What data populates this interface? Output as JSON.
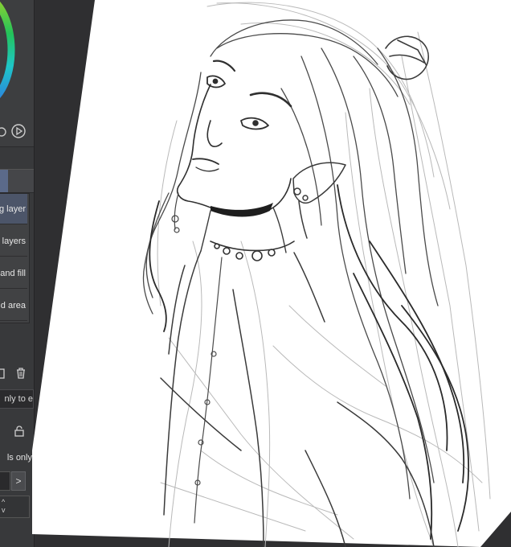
{
  "panel": {
    "menu_items": [
      {
        "label": "g layer",
        "selected": true
      },
      {
        "label": "layers",
        "selected": false
      },
      {
        "label": "and fill",
        "selected": false
      },
      {
        "label": "d area",
        "selected": false
      }
    ],
    "hint_text": "nly to e",
    "option_label": "ls only",
    "next_label": ">",
    "spinner_up": "^",
    "spinner_down": "v"
  },
  "colors": {
    "accent": "#5b6a8a",
    "background": "#2f2f31",
    "panel": "#38393b",
    "paper": "#ffffff"
  },
  "icons": [
    "color-wheel",
    "play-icon",
    "trash-icon",
    "copy-icon",
    "lock-icon",
    "chevron-right-icon"
  ]
}
